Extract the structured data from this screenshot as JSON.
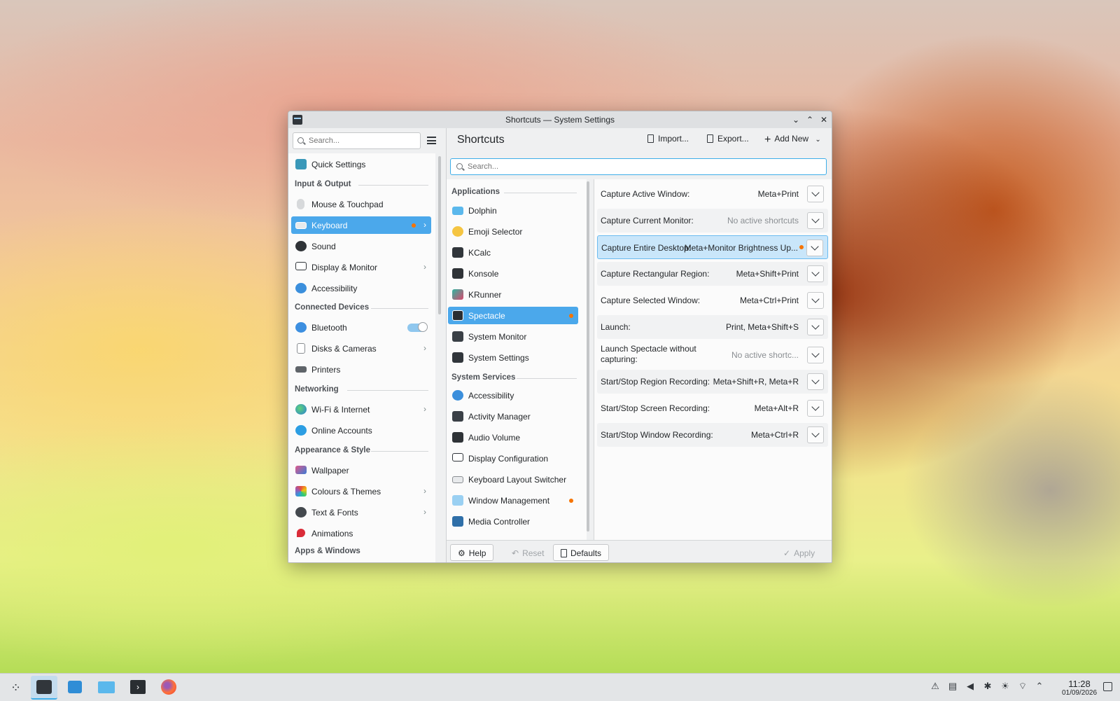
{
  "window": {
    "title": "Shortcuts — System Settings",
    "controls": {
      "minimize": "⌄",
      "maximize": "⌃",
      "close": "✕"
    }
  },
  "sidebar": {
    "search_placeholder": "Search...",
    "sections": {
      "input_output": "Input & Output",
      "connected_devices": "Connected Devices",
      "networking": "Networking",
      "appearance_style": "Appearance & Style",
      "apps_windows": "Apps & Windows"
    },
    "items": [
      {
        "label": "Quick Settings",
        "icon": "quick-settings-icon"
      },
      {
        "label": "Mouse & Touchpad",
        "icon": "mouse-icon"
      },
      {
        "label": "Keyboard",
        "icon": "keyboard-icon"
      },
      {
        "label": "Sound",
        "icon": "speaker-icon"
      },
      {
        "label": "Display & Monitor",
        "icon": "monitor-icon"
      },
      {
        "label": "Accessibility",
        "icon": "accessibility-icon"
      },
      {
        "label": "Bluetooth",
        "icon": "bluetooth-icon"
      },
      {
        "label": "Disks & Cameras",
        "icon": "disk-icon"
      },
      {
        "label": "Printers",
        "icon": "printer-icon"
      },
      {
        "label": "Wi-Fi & Internet",
        "icon": "globe-icon"
      },
      {
        "label": "Online Accounts",
        "icon": "online-accounts-icon"
      },
      {
        "label": "Wallpaper",
        "icon": "wallpaper-icon"
      },
      {
        "label": "Colours & Themes",
        "icon": "palette-icon"
      },
      {
        "label": "Text & Fonts",
        "icon": "font-icon"
      },
      {
        "label": "Animations",
        "icon": "animations-icon"
      }
    ]
  },
  "header": {
    "title": "Shortcuts",
    "import_label": "Import...",
    "export_label": "Export...",
    "add_new_label": "Add New"
  },
  "main_search_placeholder": "Search...",
  "components": {
    "applications_header": "Applications",
    "system_services_header": "System Services",
    "applications": [
      {
        "label": "Dolphin",
        "icon": "folder-icon"
      },
      {
        "label": "Emoji Selector",
        "icon": "emoji-icon"
      },
      {
        "label": "KCalc",
        "icon": "calculator-icon"
      },
      {
        "label": "Konsole",
        "icon": "terminal-icon"
      },
      {
        "label": "KRunner",
        "icon": "krunner-icon"
      },
      {
        "label": "Spectacle",
        "icon": "screenshot-icon"
      },
      {
        "label": "System Monitor",
        "icon": "system-monitor-icon"
      },
      {
        "label": "System Settings",
        "icon": "settings-icon"
      }
    ],
    "services": [
      {
        "label": "Accessibility",
        "icon": "accessibility-icon"
      },
      {
        "label": "Activity Manager",
        "icon": "activity-icon"
      },
      {
        "label": "Audio Volume",
        "icon": "audio-icon"
      },
      {
        "label": "Display Configuration",
        "icon": "monitor-icon"
      },
      {
        "label": "Keyboard Layout Switcher",
        "icon": "keyboard-icon"
      },
      {
        "label": "Window Management",
        "icon": "window-icon"
      },
      {
        "label": "Media Controller",
        "icon": "media-icon"
      }
    ]
  },
  "shortcuts": [
    {
      "name": "Capture Active Window:",
      "keys": "Meta+Print"
    },
    {
      "name": "Capture Current Monitor:",
      "keys": "No active shortcuts"
    },
    {
      "name": "Capture Entire Desktop:",
      "keys": "Meta+Monitor Brightness Up..."
    },
    {
      "name": "Capture Rectangular Region:",
      "keys": "Meta+Shift+Print"
    },
    {
      "name": "Capture Selected Window:",
      "keys": "Meta+Ctrl+Print"
    },
    {
      "name": "Launch:",
      "keys": "Print, Meta+Shift+S"
    },
    {
      "name": "Launch Spectacle without capturing:",
      "keys": "No active shortc..."
    },
    {
      "name": "Start/Stop Region Recording:",
      "keys": "Meta+Shift+R, Meta+R"
    },
    {
      "name": "Start/Stop Screen Recording:",
      "keys": "Meta+Alt+R"
    },
    {
      "name": "Start/Stop Window Recording:",
      "keys": "Meta+Ctrl+R"
    }
  ],
  "footer": {
    "help_label": "Help",
    "reset_label": "Reset",
    "defaults_label": "Defaults",
    "apply_label": "Apply"
  },
  "taskbar": {
    "time": "11:28",
    "date": "01/09/2026",
    "apps": [
      "launcher-icon",
      "system-settings-icon",
      "discover-icon",
      "dolphin-icon",
      "konsole-icon",
      "firefox-icon"
    ]
  },
  "colors": {
    "accent": "#3daee9",
    "selection": "#4ba8eb",
    "changed_dot": "#f67400"
  }
}
